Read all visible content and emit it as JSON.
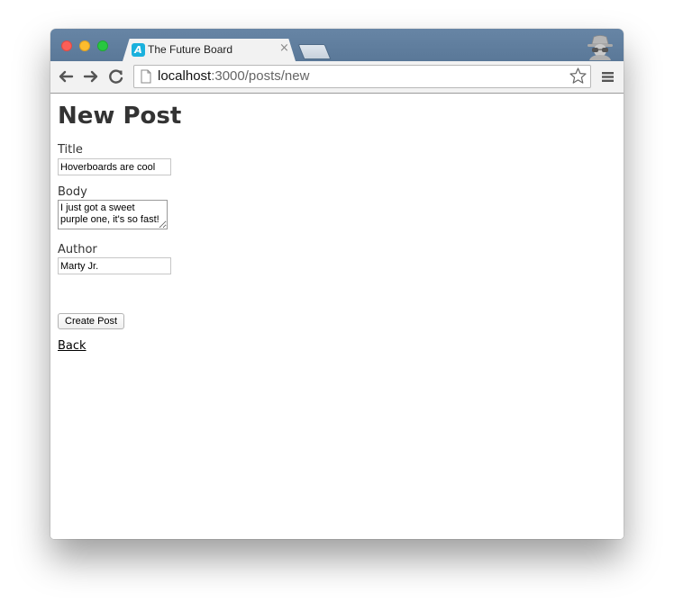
{
  "browser": {
    "tab_title": "The Future Board",
    "tab_favicon_letter": "A",
    "tab_close": "×",
    "url_host": "localhost",
    "url_path": ":3000/posts/new"
  },
  "page": {
    "title": "New Post",
    "form": {
      "title_label": "Title",
      "title_value": "Hoverboards are cool",
      "body_label": "Body",
      "body_value": "I just got a sweet purple one, it's so fast!",
      "author_label": "Author",
      "author_value": "Marty Jr.",
      "submit_label": "Create Post"
    },
    "back_link": "Back"
  },
  "icons": {
    "back": "arrow-left-icon",
    "forward": "arrow-right-icon",
    "reload": "reload-icon",
    "page": "page-icon",
    "bookmark": "star-icon",
    "menu": "hamburger-menu-icon",
    "incognito": "incognito-icon"
  },
  "colors": {
    "titlebar": "#5f7d9d",
    "favicon": "#1ab1dd",
    "heading_text": "#333333"
  }
}
